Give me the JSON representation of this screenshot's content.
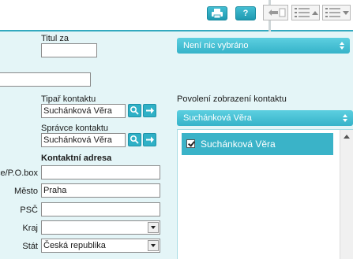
{
  "toolbar": {
    "help_label": "?"
  },
  "form": {
    "titul_za_label": "Titul za",
    "titul_za_value": "",
    "unnamed_value": "",
    "tipar_label": "Tipař kontaktu",
    "tipar_value": "Suchánková Věra",
    "spravce_label": "Správce kontaktu",
    "spravce_value": "Suchánková Věra",
    "address_heading": "Kontaktní adresa",
    "ulice_label": "Ulice/P.O.box",
    "ulice_value": "",
    "mesto_label": "Město",
    "mesto_value": "Praha",
    "psc_label": "PSČ",
    "psc_value": "",
    "kraj_label": "Kraj",
    "kraj_value": "",
    "stat_label": "Stát",
    "stat_value": "Česká republika"
  },
  "right_panel": {
    "top_dropdown_value": "Není nic vybráno",
    "visibility_label": "Povolení zobrazení kontaktu",
    "visibility_dropdown_value": "Suchánková Věra",
    "list_items": [
      {
        "label": "Suchánková Věra",
        "checked": true
      }
    ]
  },
  "colors": {
    "accent": "#36b3c9",
    "background": "#e4f5f7"
  },
  "icons": {
    "print": "printer-icon",
    "help": "question-icon",
    "search": "magnifier-icon",
    "go": "arrow-right-icon"
  }
}
